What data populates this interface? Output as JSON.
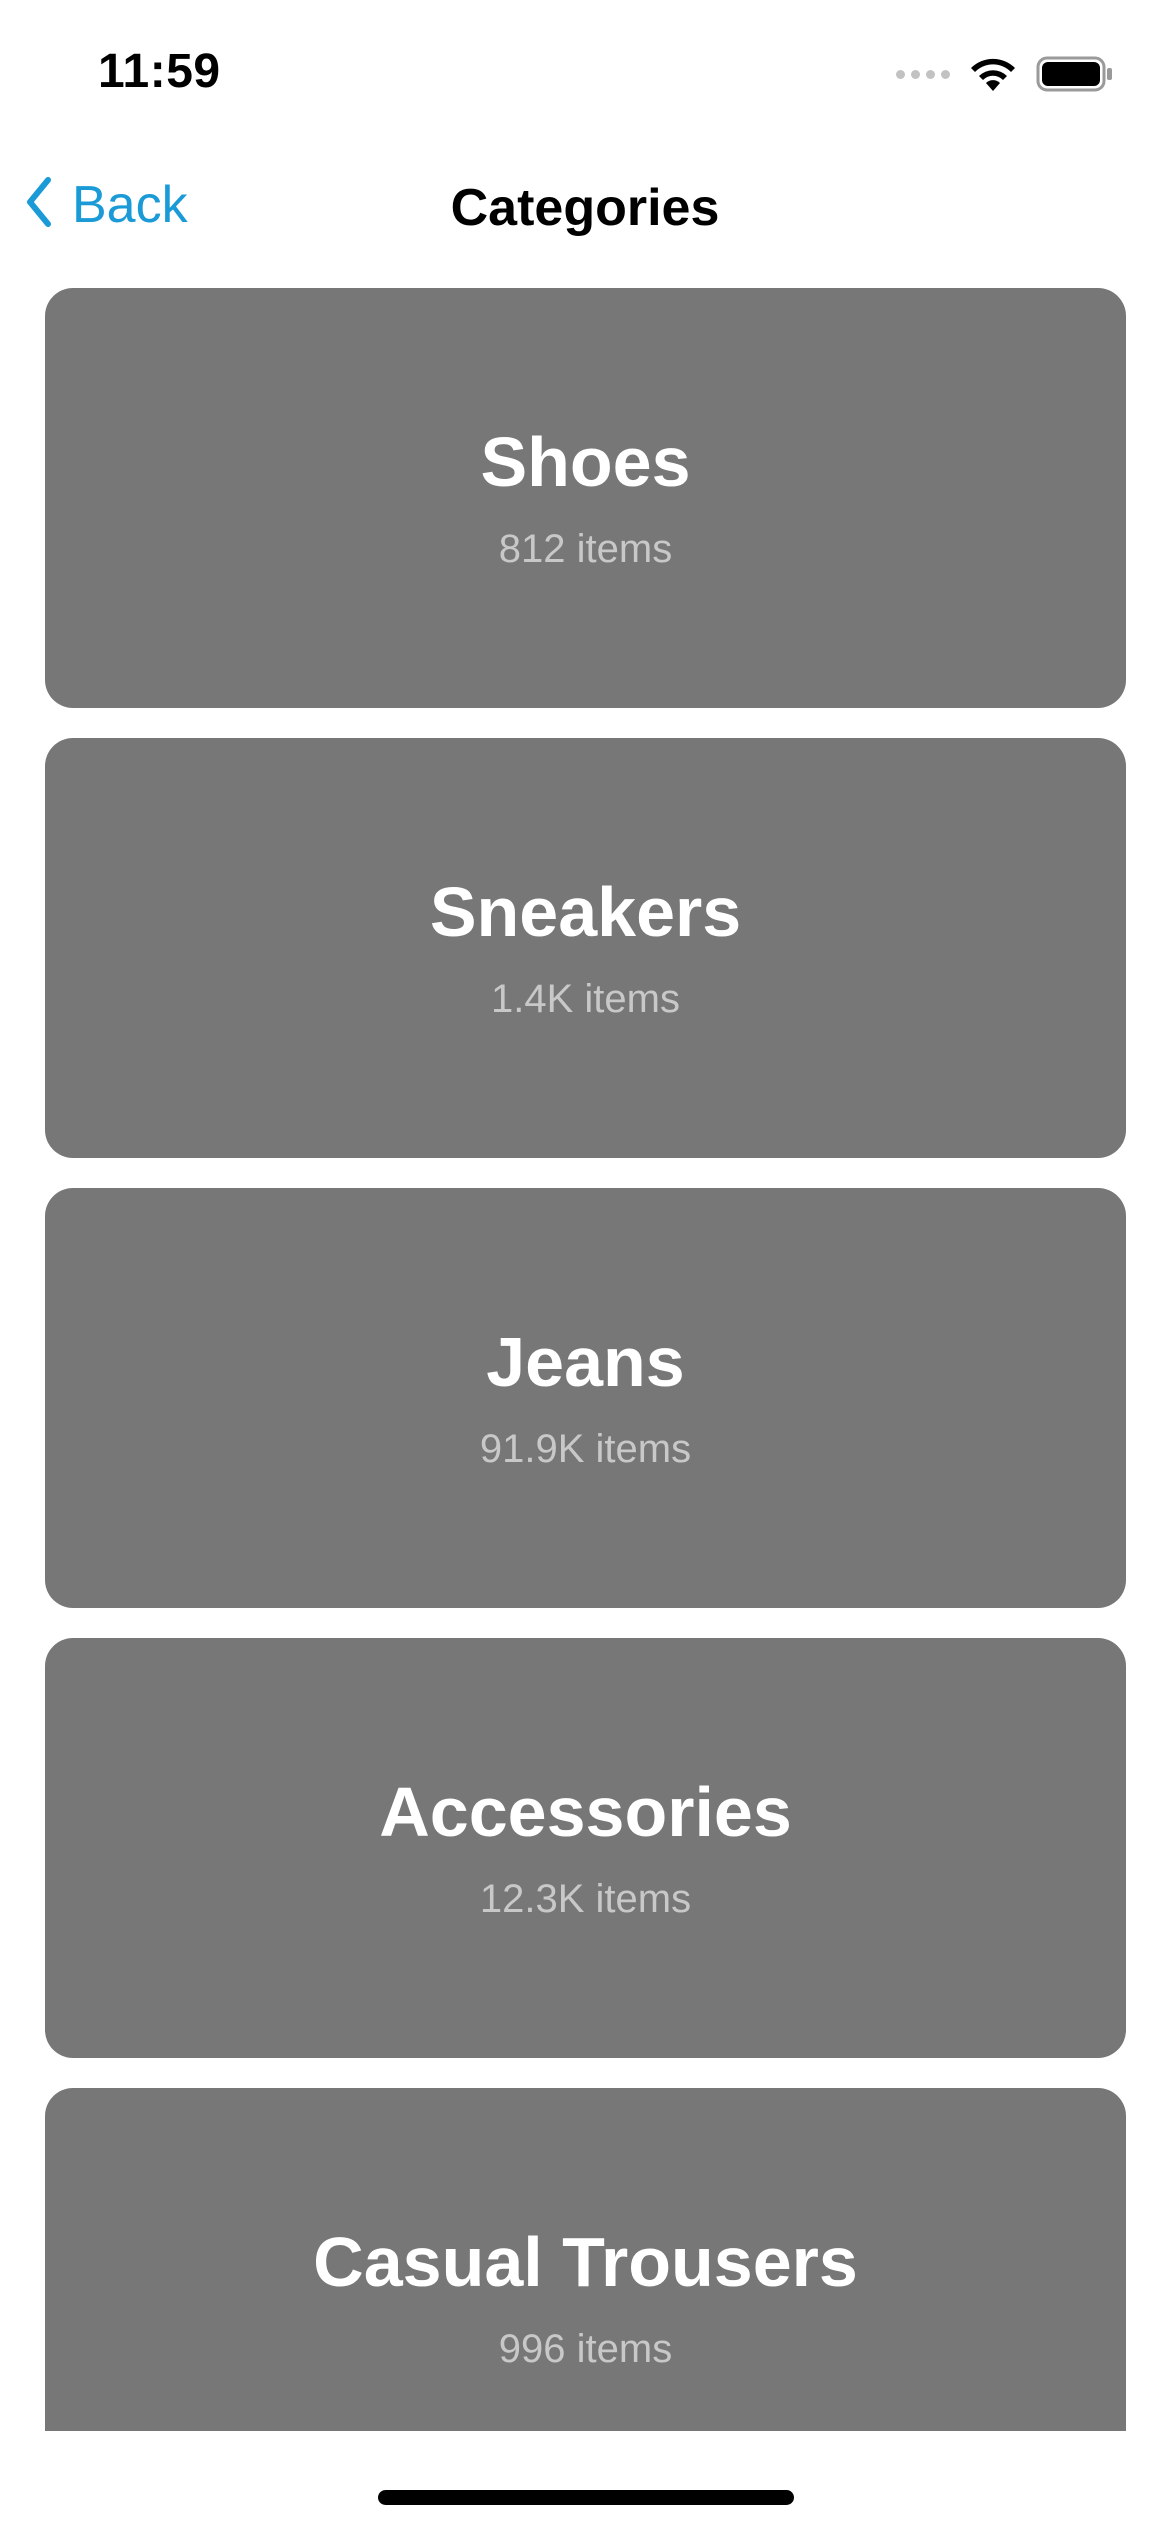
{
  "status_bar": {
    "time": "11:59"
  },
  "nav": {
    "back_label": "Back",
    "title": "Categories"
  },
  "colors": {
    "accent": "#1a9bd7",
    "card_background": "#777777",
    "card_title": "#ffffff",
    "card_subtitle": "#c8c8c8"
  },
  "icons": {
    "back": "chevron-left-icon",
    "wifi": "wifi-icon",
    "battery": "battery-icon",
    "signal": "cellular-signal-icon"
  },
  "categories": [
    {
      "name": "Shoes",
      "count": "812 items"
    },
    {
      "name": "Sneakers",
      "count": "1.4K items"
    },
    {
      "name": "Jeans",
      "count": "91.9K items"
    },
    {
      "name": "Accessories",
      "count": "12.3K items"
    },
    {
      "name": "Casual Trousers",
      "count": "996 items"
    }
  ]
}
